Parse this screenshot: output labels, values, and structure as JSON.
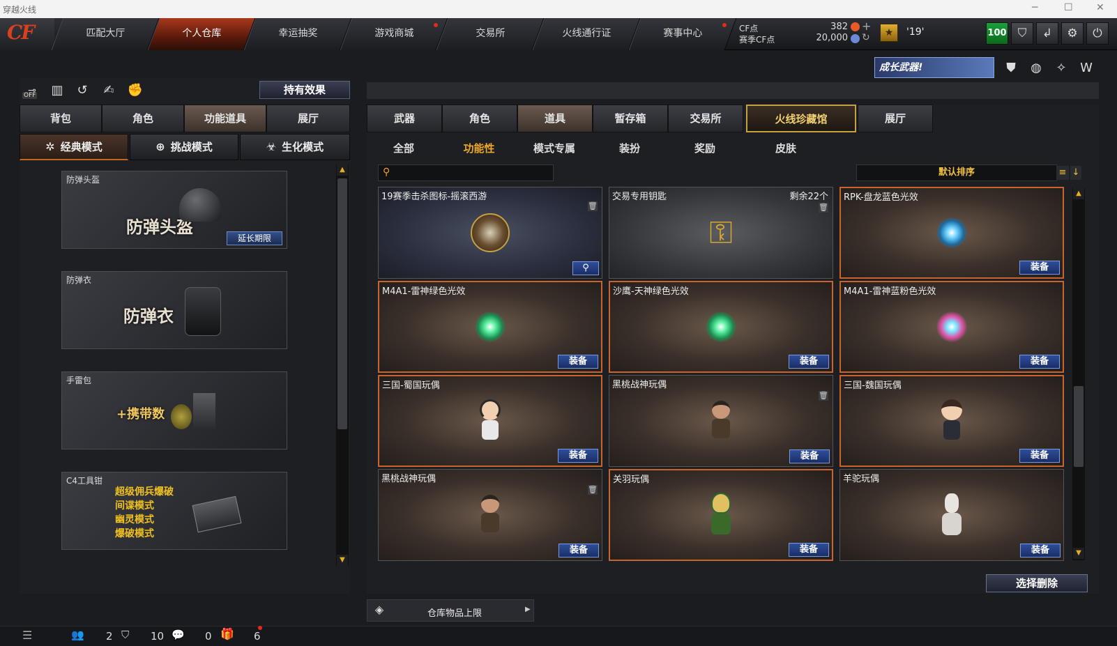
{
  "window": {
    "title": "穿越火线"
  },
  "nav": {
    "tabs": [
      "匹配大厅",
      "个人仓库",
      "幸运抽奖",
      "游戏商城",
      "交易所",
      "火线通行证",
      "赛事中心"
    ],
    "active_index": 1
  },
  "currency": {
    "cf_label": "CF点",
    "cf_value": "382",
    "season_label": "赛季CF点",
    "season_value": "20,000",
    "rank_value": "'19'",
    "level": "100"
  },
  "banner": {
    "text": "成长武器!"
  },
  "left": {
    "effects_button": "持有效果",
    "off_label": "OFF",
    "tabs": [
      "背包",
      "角色",
      "功能道具",
      "展厅"
    ],
    "active_tab": 2,
    "modes": [
      "经典模式",
      "挑战模式",
      "生化模式"
    ],
    "active_mode": 0,
    "cards": [
      {
        "title": "防弹头盔",
        "big": "防弹头盔",
        "button": "延长期限"
      },
      {
        "title": "防弹衣",
        "big": "防弹衣"
      },
      {
        "title": "手雷包",
        "big": "+携带数"
      },
      {
        "title": "C4工具钳",
        "lines": [
          "超级佣兵爆破",
          "间谍模式",
          "幽灵模式",
          "爆破模式"
        ]
      }
    ]
  },
  "right": {
    "tabs": [
      "武器",
      "角色",
      "道具",
      "暂存箱",
      "交易所",
      "火线珍藏馆",
      "展厅"
    ],
    "active_tab": 2,
    "subtabs": [
      "全部",
      "功能性",
      "模式专属",
      "装扮",
      "奖励",
      "皮肤"
    ],
    "active_subtab": 1,
    "search_placeholder": "",
    "sort_label": "默认排序",
    "equip_label": "装备",
    "items": [
      {
        "name": "19赛季击杀图标-摇滚西游"
      },
      {
        "name": "交易专用钥匙",
        "remain": "剩余22个"
      },
      {
        "name": "RPK-盘龙蓝色光效"
      },
      {
        "name": "M4A1-雷神绿色光效"
      },
      {
        "name": "沙鹰-天神绿色光效"
      },
      {
        "name": "M4A1-雷神蓝粉色光效"
      },
      {
        "name": "三国-蜀国玩偶"
      },
      {
        "name": "黑桃战神玩偶"
      },
      {
        "name": "三国-魏国玩偶"
      },
      {
        "name": "黑桃战神玩偶"
      },
      {
        "name": "关羽玩偶"
      },
      {
        "name": "羊驼玩偶"
      }
    ],
    "delete_button": "选择删除",
    "storage_label": "仓库物品上限"
  },
  "footer": {
    "count_shield": "2",
    "count_chat": "10",
    "count_gift": "0",
    "count_last": "6"
  }
}
